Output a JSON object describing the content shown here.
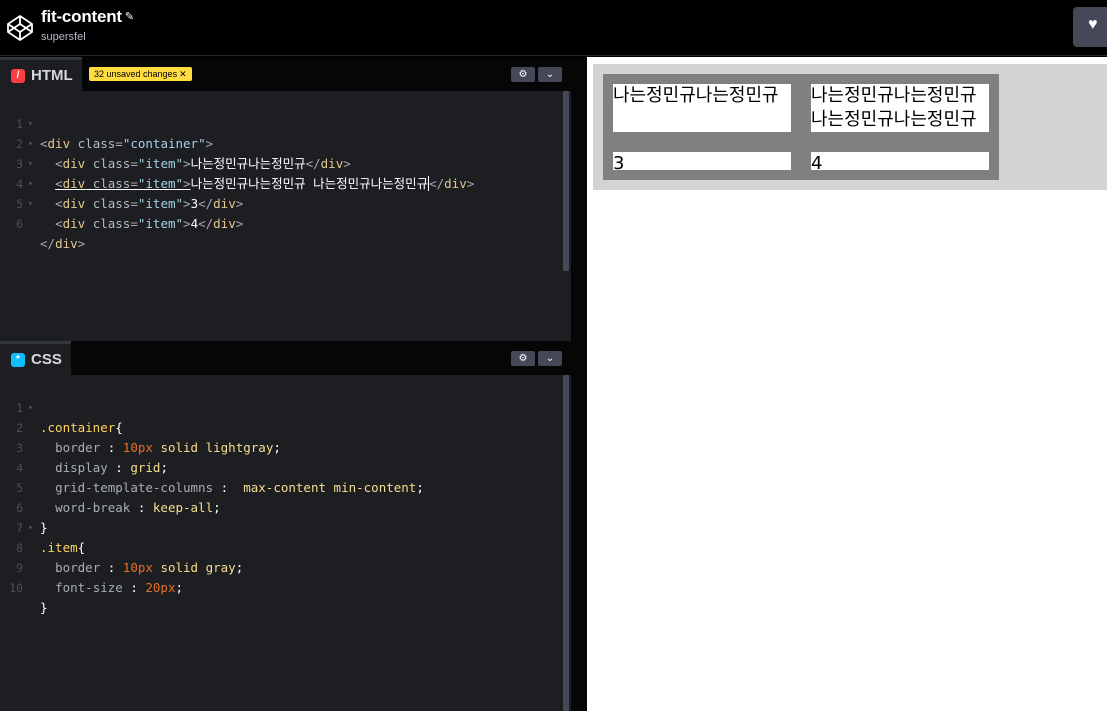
{
  "header": {
    "title": "fit-content",
    "author": "supersfel"
  },
  "html_pane": {
    "label": "HTML",
    "icon": "html-icon",
    "icon_color": "#ff3c41",
    "unsaved_badge": "32 unsaved changes",
    "lines": [
      {
        "n": "1",
        "fold": "▾"
      },
      {
        "n": "2",
        "fold": "▾"
      },
      {
        "n": "3",
        "fold": "▾"
      },
      {
        "n": "4",
        "fold": "▾"
      },
      {
        "n": "5",
        "fold": "▾"
      },
      {
        "n": "6",
        "fold": ""
      }
    ],
    "code": {
      "open_tag": "div",
      "class_attr": "class",
      "container_cls": "\"container\"",
      "item_cls": "\"item\"",
      "text1": "나는정민규나는정민규",
      "text2": "나는정민규나는정민규 나는정민규나는정민규",
      "text3": "3",
      "text4": "4"
    }
  },
  "css_pane": {
    "label": "CSS",
    "icon": "css-icon",
    "icon_color": "#0ebeff",
    "lines": [
      "1",
      "2",
      "3",
      "4",
      "5",
      "6",
      "7",
      "8",
      "9",
      "10"
    ],
    "code": {
      "sel1": ".container",
      "sel2": ".item",
      "p_border": "border",
      "p_display": "display",
      "p_gtc": "grid-template-columns",
      "p_wb": "word-break",
      "p_fs": "font-size",
      "v_10px": "10px",
      "v_solid": "solid",
      "v_lightgray": "lightgray",
      "v_grid": "grid",
      "v_max": "max-content",
      "v_min": "min-content",
      "v_keep": "keep-all",
      "v_gray": "gray",
      "v_20px": "20px"
    }
  },
  "preview": {
    "item1": "나는정민규나는정민규",
    "item2_line1": "나는정민규나는정민규",
    "item2_line2": "나는정민규나는정민규",
    "item3": "3",
    "item4": "4"
  },
  "colors": {
    "accent_yellow": "#ffdd40",
    "editor_bg": "#1d1e22",
    "container_border": "#d3d3d3",
    "item_border": "#808080"
  }
}
